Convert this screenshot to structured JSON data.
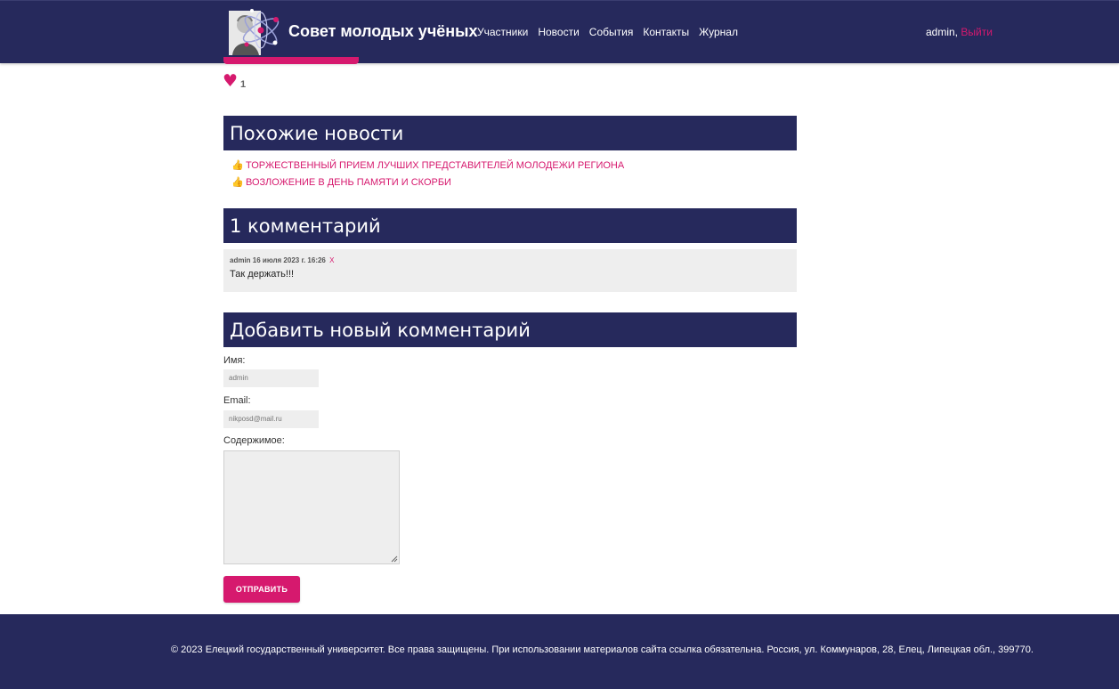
{
  "header": {
    "site_title": "Совет молодых учёных",
    "nav": [
      "Участники",
      "Новости",
      "События",
      "Контакты",
      "Журнал"
    ],
    "user": "admin,",
    "logout": "Выйти"
  },
  "likes": {
    "count": "1"
  },
  "related": {
    "title": "Похожие новости",
    "items": [
      "ТОРЖЕСТВЕННЫЙ ПРИЕМ ЛУЧШИХ ПРЕДСТАВИТЕЛЕЙ МОЛОДЕЖИ РЕГИОНА",
      "ВОЗЛОЖЕНИЕ В ДЕНЬ ПАМЯТИ И СКОРБИ"
    ]
  },
  "comments": {
    "title": "1 комментарий",
    "items": [
      {
        "meta": "admin 16 июля 2023 г. 16:26",
        "delete": "X",
        "text": "Так держать!!!"
      }
    ]
  },
  "form": {
    "title": "Добавить новый комментарий",
    "name_label": "Имя:",
    "name_value": "admin",
    "email_label": "Email:",
    "email_value": "nikposd@mail.ru",
    "content_label": "Содержимое:",
    "submit_label": "ОТПРАВИТЬ"
  },
  "footer": {
    "text": "© 2023 Елецкий государственный университет. Все права защищены. При использовании материалов сайта ссылка обязательна. Россия, ул. Коммунаров, 28, Елец, Липецкая обл., 399770."
  },
  "colors": {
    "navy": "#26295c",
    "accent": "#d6196e",
    "panel": "#eeeeee"
  }
}
